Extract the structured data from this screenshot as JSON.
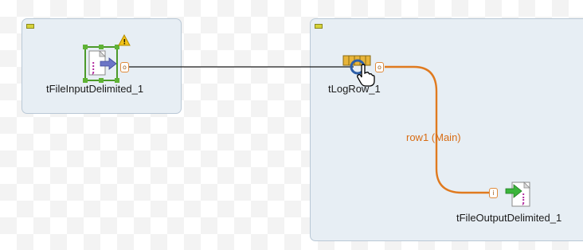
{
  "canvas": {
    "subjobs": [
      {
        "component_label": "tFileInputDelimited_1"
      },
      {
        "component_labels": [
          "tLogRow_1",
          "tFileOutputDelimited_1"
        ]
      }
    ],
    "connection": {
      "label": "row1 (Main)"
    },
    "warning_glyph": "!",
    "colors": {
      "subjob_fill": "#e7eef4",
      "main_link": "#e07a1f",
      "selection": "#4c9a2a",
      "warning": "#f2c318"
    }
  }
}
